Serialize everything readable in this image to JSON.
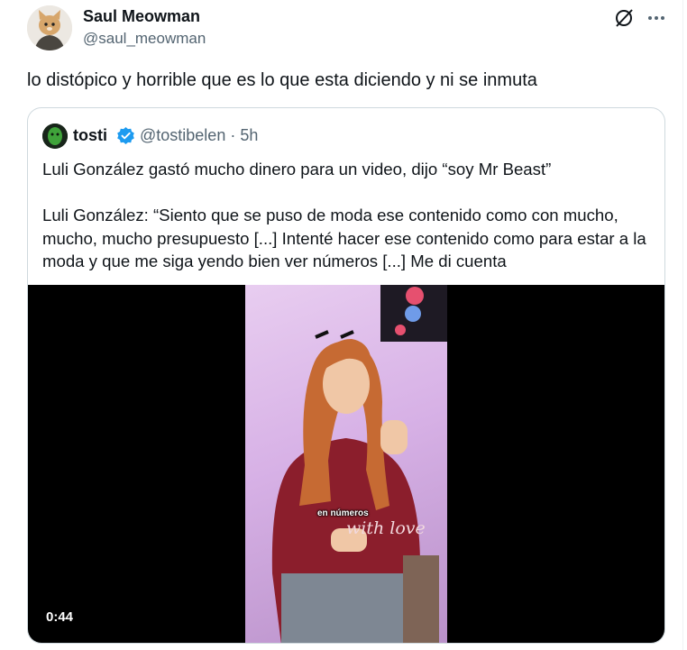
{
  "tweet": {
    "author_name": "Saul Meowman",
    "author_handle": "@saul_meowman",
    "text": "lo distópico y horrible que es lo que esta diciendo y ni se inmuta"
  },
  "quoted": {
    "name": "tosti",
    "handle": "@tostibelen",
    "separator": " · ",
    "time": "5h",
    "text": "Luli González gastó mucho dinero para un video, dijo “soy Mr Beast”\n\nLuli González: “Siento que se puso de moda ese contenido como con mucho, mucho, mucho presupuesto [...] Intenté hacer ese contenido como para estar a la moda y que me siga yendo bien ver números [...] Me di cuenta",
    "video": {
      "caption": "en números",
      "shirt_text": "with love",
      "duration": "0:44"
    }
  },
  "colors": {
    "text_primary": "#0f1419",
    "text_secondary": "#536471",
    "verified_blue": "#1d9bf0",
    "border": "#cfd9de"
  },
  "icons": {
    "grok": "grok-icon",
    "more": "more-icon",
    "verified": "verified-badge-icon"
  }
}
